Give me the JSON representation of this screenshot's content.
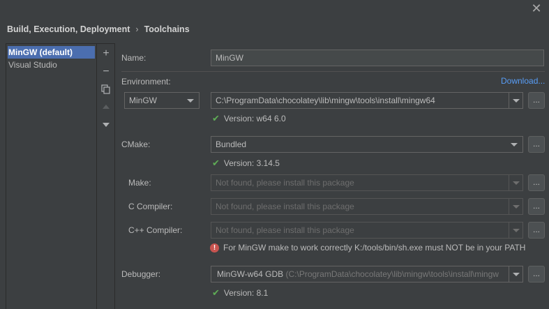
{
  "breadcrumb": {
    "parent": "Build, Execution, Deployment",
    "separator": "›",
    "current": "Toolchains"
  },
  "toolchains": [
    {
      "label": "MinGW (default)",
      "selected": true
    },
    {
      "label": "Visual Studio",
      "selected": false
    }
  ],
  "toolbar": {
    "add": "+",
    "remove": "−",
    "copy": "copy-icon",
    "up": "arrow-up-icon",
    "down": "arrow-down-icon"
  },
  "form": {
    "name_label": "Name:",
    "name_value": "MinGW",
    "env_label": "Environment:",
    "download_link": "Download...",
    "env_type": "MinGW",
    "env_path": "C:\\ProgramData\\chocolatey\\lib\\mingw\\tools\\install\\mingw64",
    "env_version": "Version: w64 6.0",
    "cmake_label": "CMake:",
    "cmake_value": "Bundled",
    "cmake_version": "Version: 3.14.5",
    "make_label": "Make:",
    "make_placeholder": "Not found, please install this package",
    "c_label": "C Compiler:",
    "c_placeholder": "Not found, please install this package",
    "cpp_label": "C++ Compiler:",
    "cpp_placeholder": "Not found, please install this package",
    "error_text": "For MinGW make to work correctly K:/tools/bin/sh.exe must NOT be in your PATH",
    "debugger_label": "Debugger:",
    "debugger_value": "MinGW-w64 GDB",
    "debugger_path": "(C:\\ProgramData\\chocolatey\\lib\\mingw\\tools\\install\\mingw",
    "debugger_version": "Version: 8.1",
    "browse": "..."
  },
  "colors": {
    "accent": "#4b6eaf",
    "link": "#589df6",
    "success": "#5fad56",
    "error": "#c75450"
  }
}
